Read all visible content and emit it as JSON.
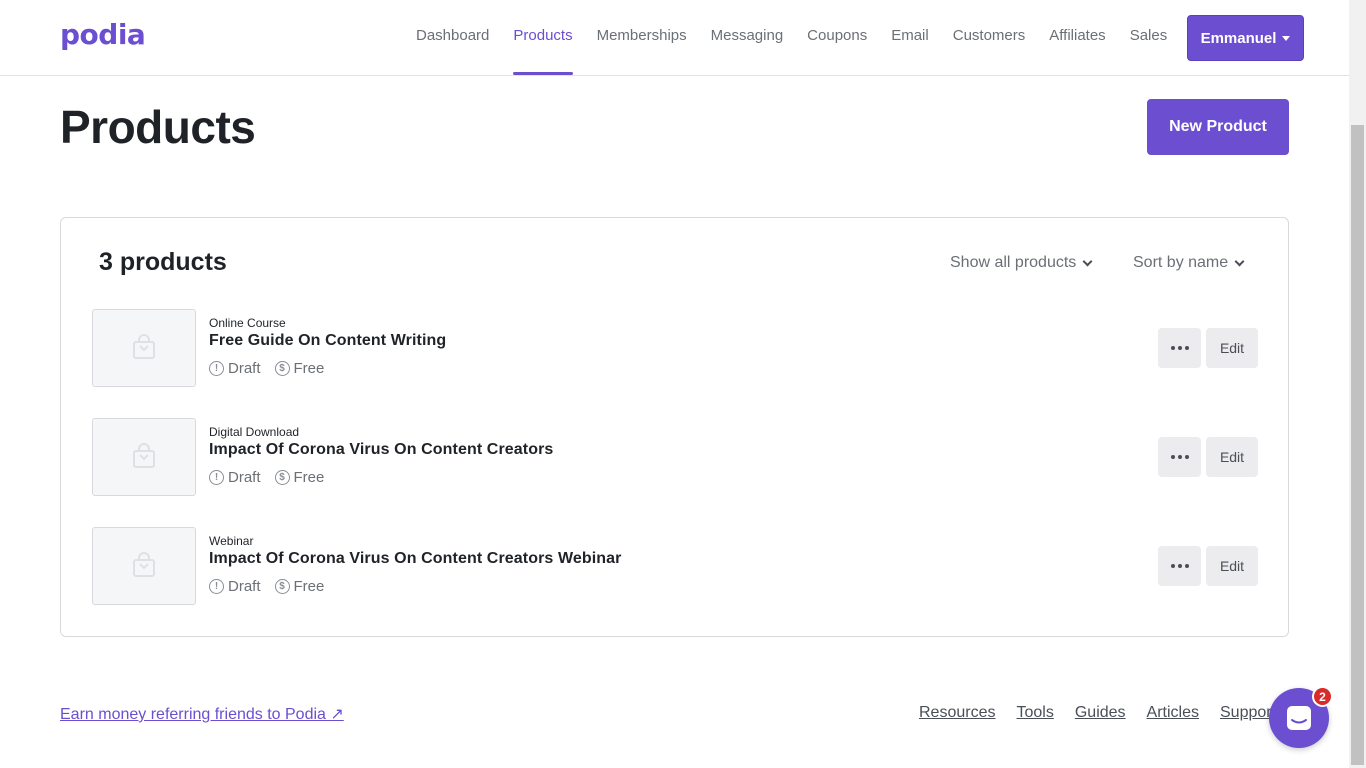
{
  "header": {
    "logo": "podia",
    "nav": [
      {
        "label": "Dashboard",
        "active": false
      },
      {
        "label": "Products",
        "active": true
      },
      {
        "label": "Memberships",
        "active": false
      },
      {
        "label": "Messaging",
        "active": false
      },
      {
        "label": "Coupons",
        "active": false
      },
      {
        "label": "Email",
        "active": false
      },
      {
        "label": "Customers",
        "active": false
      },
      {
        "label": "Affiliates",
        "active": false
      },
      {
        "label": "Sales",
        "active": false
      }
    ],
    "user_label": "Emmanuel"
  },
  "page": {
    "title": "Products",
    "new_button": "New Product"
  },
  "list": {
    "count_label": "3 products",
    "filter_label": "Show all products",
    "sort_label": "Sort by name",
    "items": [
      {
        "type": "Online Course",
        "name": "Free Guide On Content Writing",
        "status": "Draft",
        "price": "Free",
        "more_label": "...",
        "edit_label": "Edit"
      },
      {
        "type": "Digital Download",
        "name": "Impact Of Corona Virus On Content Creators",
        "status": "Draft",
        "price": "Free",
        "more_label": "...",
        "edit_label": "Edit"
      },
      {
        "type": "Webinar",
        "name": "Impact Of Corona Virus On Content Creators Webinar",
        "status": "Draft",
        "price": "Free",
        "more_label": "...",
        "edit_label": "Edit"
      }
    ]
  },
  "footer": {
    "referral_link": "Earn money referring friends to Podia ↗",
    "links": [
      "Resources",
      "Tools",
      "Guides",
      "Articles",
      "Support"
    ]
  },
  "chat": {
    "badge_count": "2"
  },
  "colors": {
    "accent": "#6b4fd0",
    "badge": "#d92b2b"
  }
}
